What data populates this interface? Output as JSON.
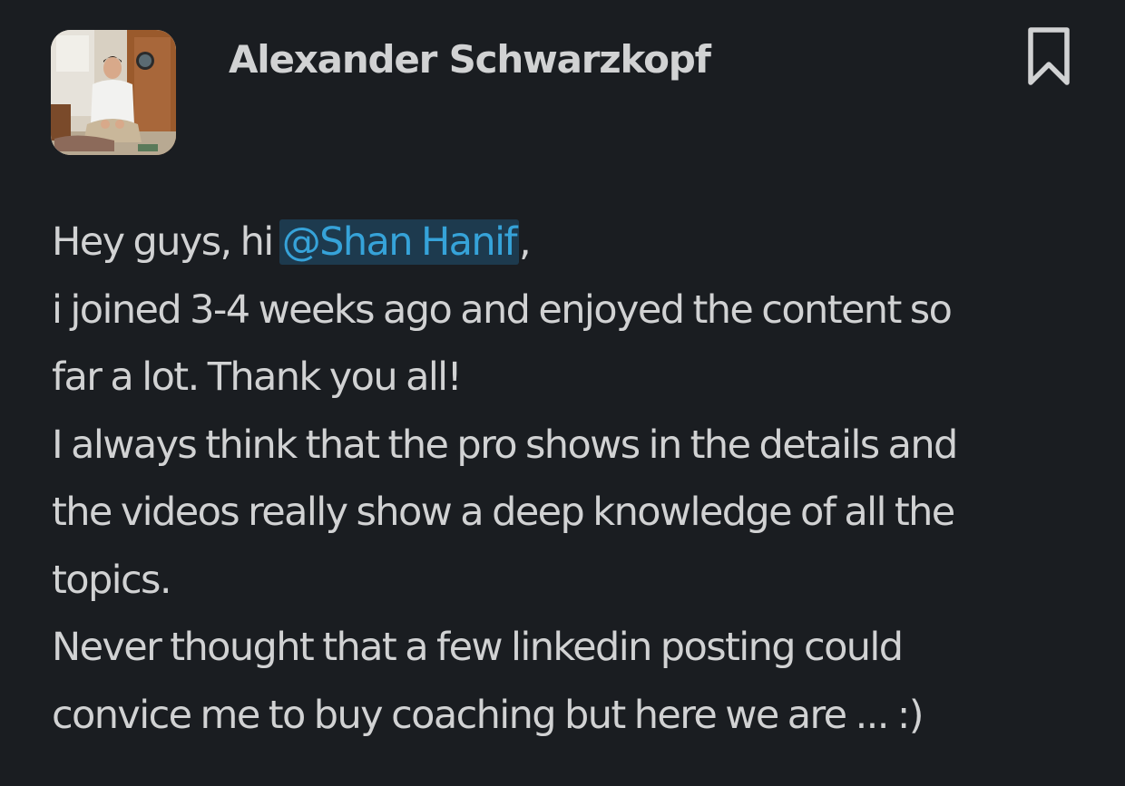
{
  "message": {
    "author": "Alexander Schwarzkopf",
    "greeting_before": "Hey guys, hi ",
    "mention": "@Shan Hanif",
    "greeting_after": ",",
    "lines": [
      "i joined 3-4 weeks ago and enjoyed the content so",
      "far a lot. Thank you all!",
      "I always think that the pro shows in the details and",
      "the videos really show a deep knowledge of all the",
      "topics.",
      "Never thought that a few linkedin posting could",
      "convice me to buy coaching but here we are ... :)"
    ]
  },
  "icons": {
    "bookmark": "bookmark-icon"
  },
  "colors": {
    "background": "#1a1d21",
    "text": "#d1d2d3",
    "mention_text": "#36a3d9",
    "mention_bg": "#1d3a4e"
  }
}
